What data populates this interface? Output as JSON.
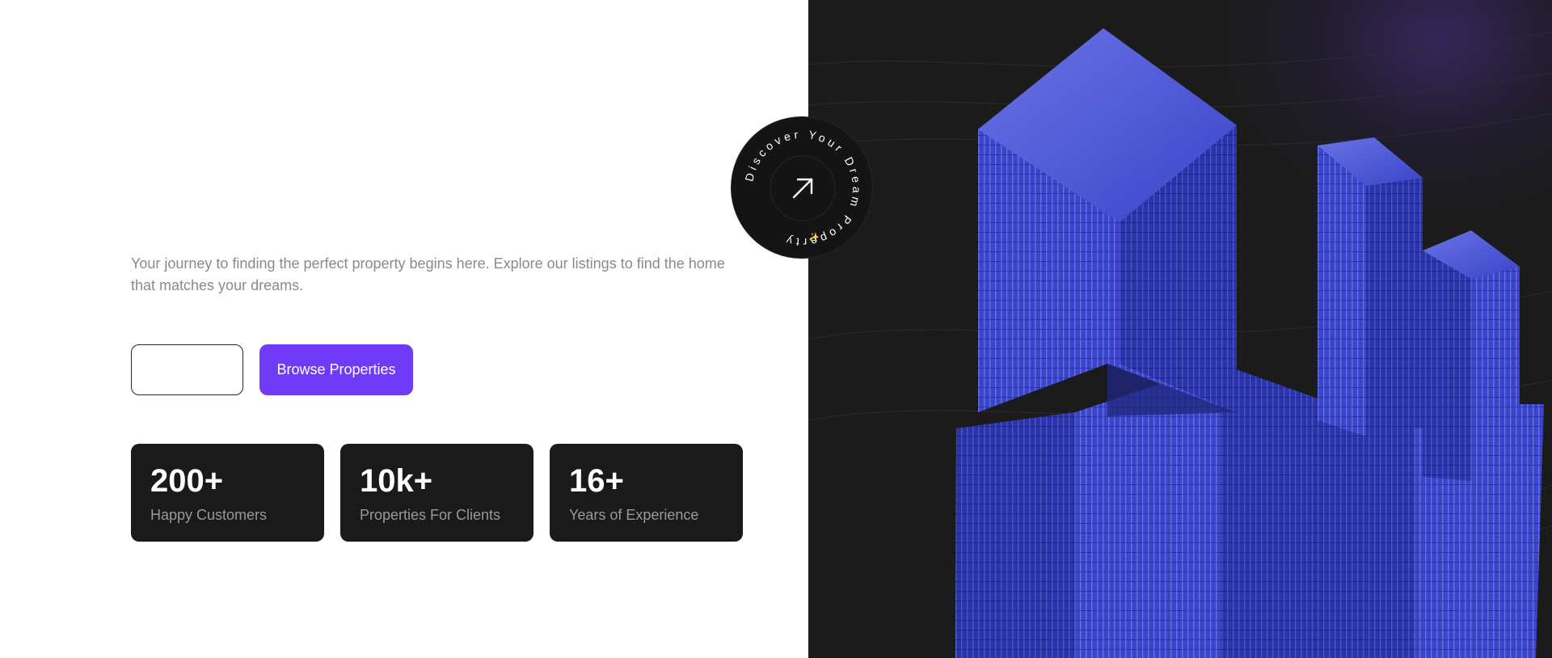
{
  "hero": {
    "description": "Your journey to finding the perfect property begins here. Explore our listings to find the home that matches your dreams.",
    "buttons": {
      "secondary_label": "",
      "primary_label": "Browse Properties"
    }
  },
  "stats": [
    {
      "value": "200+",
      "label": "Happy Customers"
    },
    {
      "value": "10k+",
      "label": "Properties For Clients"
    },
    {
      "value": "16+",
      "label": "Years of Experience"
    }
  ],
  "badge": {
    "circular_text": "Discover Your Dream Property",
    "icon": "arrow-up-right-icon",
    "sparkle": "✨"
  },
  "image": {
    "subject": "building-illustration"
  },
  "colors": {
    "primary": "#703bf7",
    "dark_panel": "#1a1a1a",
    "building_blue": "#3a45c9"
  }
}
